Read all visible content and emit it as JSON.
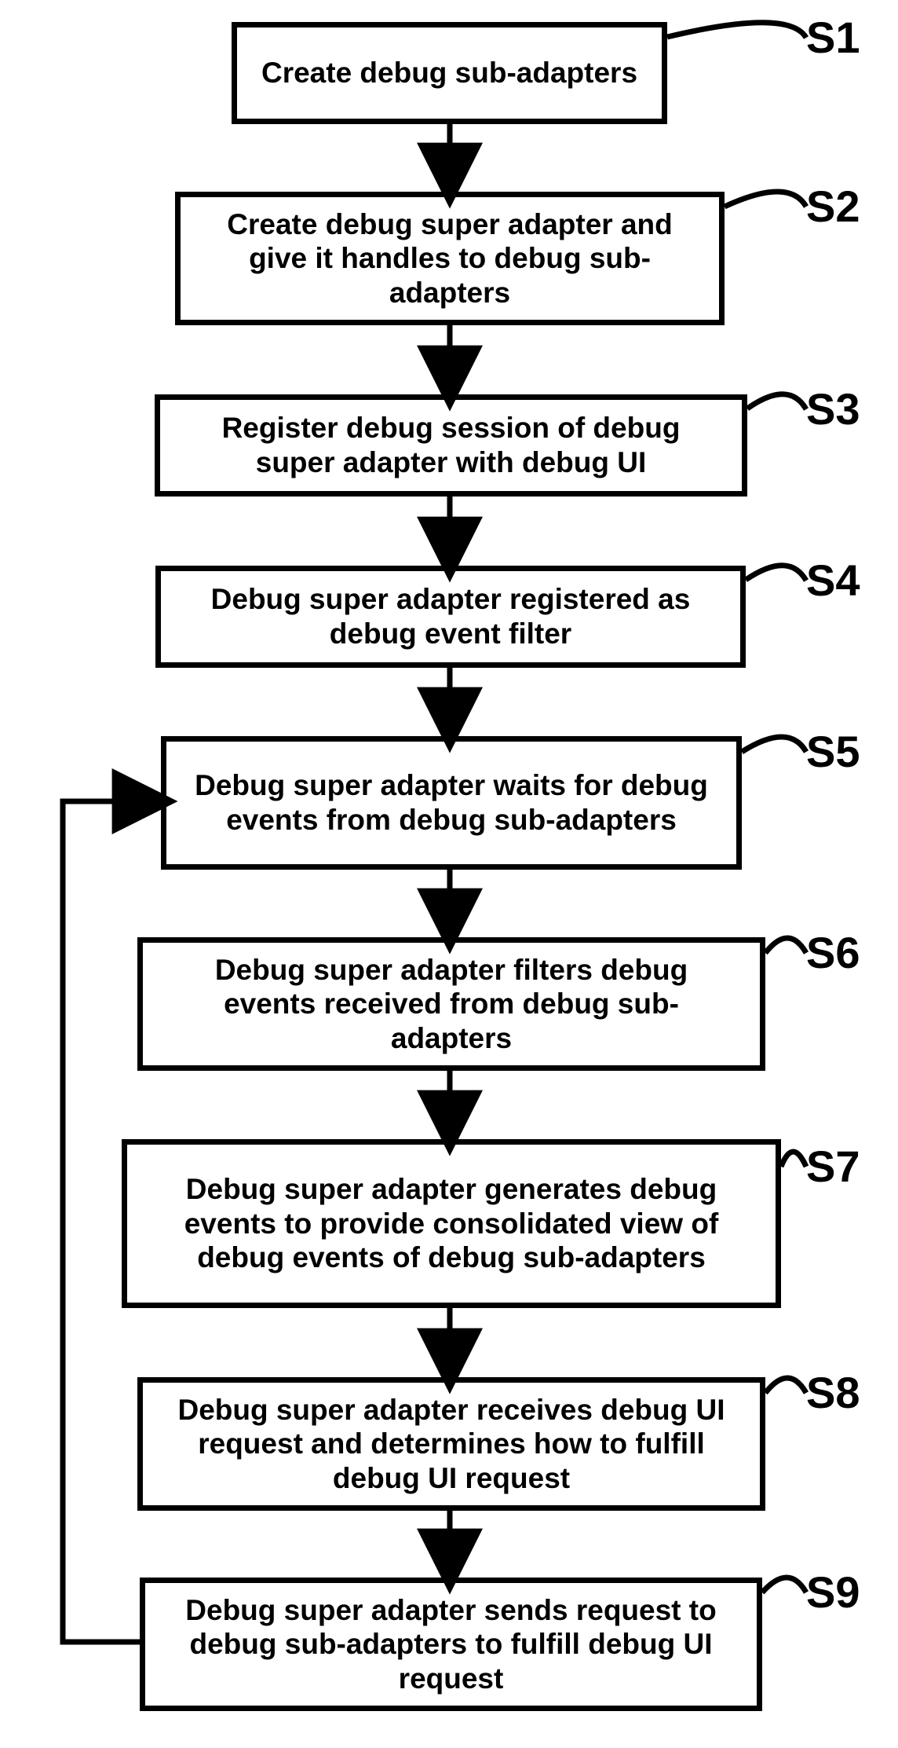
{
  "chart_data": {
    "type": "flowchart",
    "nodes": [
      {
        "id": "S1",
        "label": "S1",
        "text": "Create debug sub-adapters"
      },
      {
        "id": "S2",
        "label": "S2",
        "text": "Create debug super adapter and give it handles to debug sub-adapters"
      },
      {
        "id": "S3",
        "label": "S3",
        "text": "Register debug session of debug super adapter with debug UI"
      },
      {
        "id": "S4",
        "label": "S4",
        "text": "Debug super adapter registered as debug event filter"
      },
      {
        "id": "S5",
        "label": "S5",
        "text": "Debug super adapter waits for debug events from debug sub-adapters"
      },
      {
        "id": "S6",
        "label": "S6",
        "text": "Debug super adapter filters debug events received from debug sub-adapters"
      },
      {
        "id": "S7",
        "label": "S7",
        "text": "Debug super adapter generates debug events to provide consolidated view of debug events of debug sub-adapters"
      },
      {
        "id": "S8",
        "label": "S8",
        "text": "Debug super adapter receives debug UI request and determines how to fulfill debug UI request"
      },
      {
        "id": "S9",
        "label": "S9",
        "text": "Debug super adapter sends request to debug sub-adapters to fulfill debug UI request"
      }
    ],
    "edges": [
      {
        "from": "S1",
        "to": "S2"
      },
      {
        "from": "S2",
        "to": "S3"
      },
      {
        "from": "S3",
        "to": "S4"
      },
      {
        "from": "S4",
        "to": "S5"
      },
      {
        "from": "S5",
        "to": "S6"
      },
      {
        "from": "S6",
        "to": "S7"
      },
      {
        "from": "S7",
        "to": "S8"
      },
      {
        "from": "S8",
        "to": "S9"
      },
      {
        "from": "S9",
        "to": "S5",
        "kind": "loop"
      }
    ]
  }
}
